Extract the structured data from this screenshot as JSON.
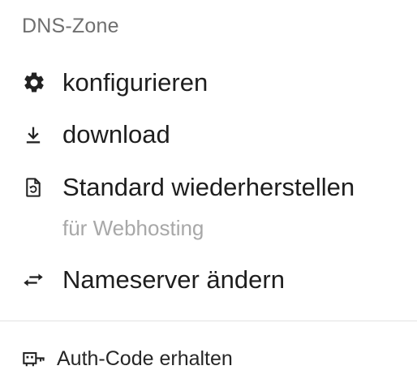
{
  "section": {
    "title": "DNS-Zone"
  },
  "menu": {
    "items": [
      {
        "label": "konfigurieren",
        "icon": "gear-icon"
      },
      {
        "label": "download",
        "icon": "download-icon"
      },
      {
        "label": "Standard wiederherstellen",
        "icon": "restore-document-icon",
        "sublabel": "für Webhosting"
      },
      {
        "label": "Nameserver ändern",
        "icon": "swap-arrows-icon"
      }
    ]
  },
  "footer": {
    "auth_code_label": "Auth-Code erhalten",
    "auth_code_icon": "key-code-icon"
  },
  "colors": {
    "title": "#6f6f6f",
    "text": "#1e1e1e",
    "sublabel": "#a8a8a8",
    "divider": "#e2e2e2"
  }
}
